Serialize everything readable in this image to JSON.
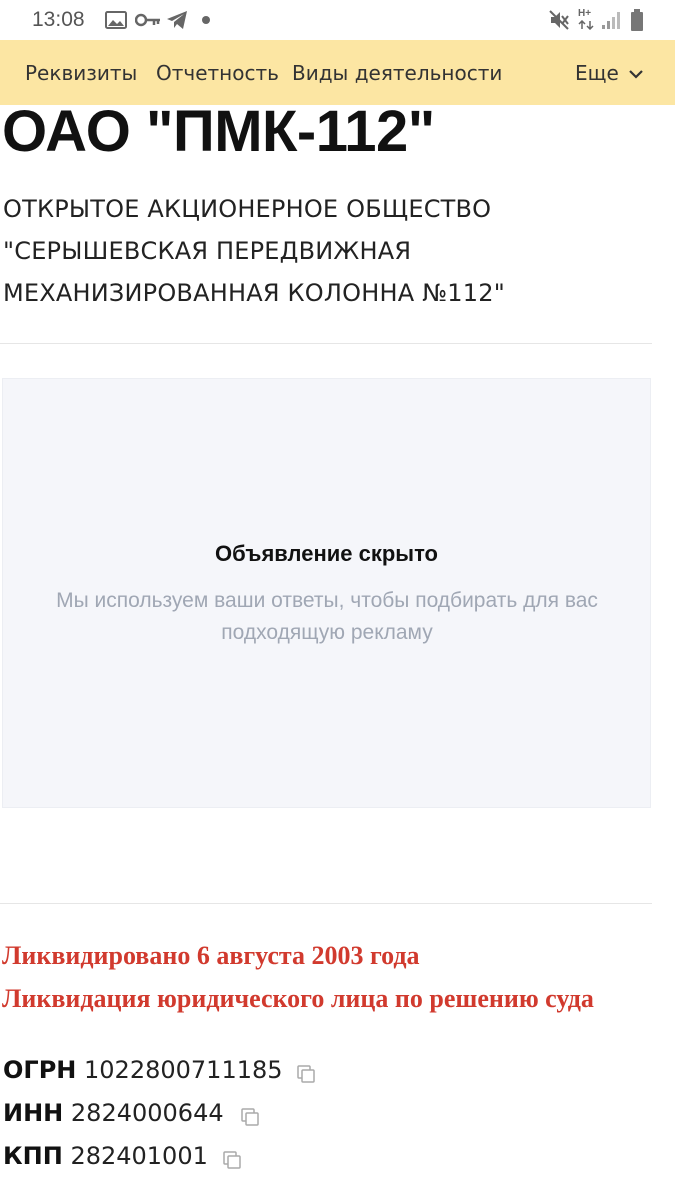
{
  "status_bar": {
    "time": "13:08",
    "icons": [
      "image-icon",
      "key-icon",
      "telegram-icon",
      "dot-icon",
      "mute-icon",
      "network-h-plus-icon",
      "signal-icon",
      "battery-icon"
    ],
    "network_label": "H+"
  },
  "tabs": {
    "items": [
      "Реквизиты",
      "Отчетность",
      "Виды деятельности"
    ],
    "more_label": "Еще",
    "bar_color": "#fce6a3"
  },
  "company": {
    "short_name": "ОАО \"ПМК-112\"",
    "full_name": "ОТКРЫТОЕ АКЦИОНЕРНОЕ ОБЩЕСТВО \"СЕРЫШЕВСКАЯ ПЕРЕДВИЖНАЯ МЕХАНИЗИРОВАННАЯ КОЛОННА №112\""
  },
  "ad": {
    "title": "Объявление скрыто",
    "text": "Мы используем ваши ответы, чтобы подбирать для вас подходящую рекламу"
  },
  "status": {
    "liquidated": "Ликвидировано 6 августа 2003 года",
    "reason": "Ликвидация юридического лица по решению суда",
    "color": "#d13a2e"
  },
  "requisites": [
    {
      "label": "ОГРН",
      "value": "1022800711185"
    },
    {
      "label": "ИНН",
      "value": "2824000644"
    },
    {
      "label": "КПП",
      "value": "282401001"
    }
  ]
}
